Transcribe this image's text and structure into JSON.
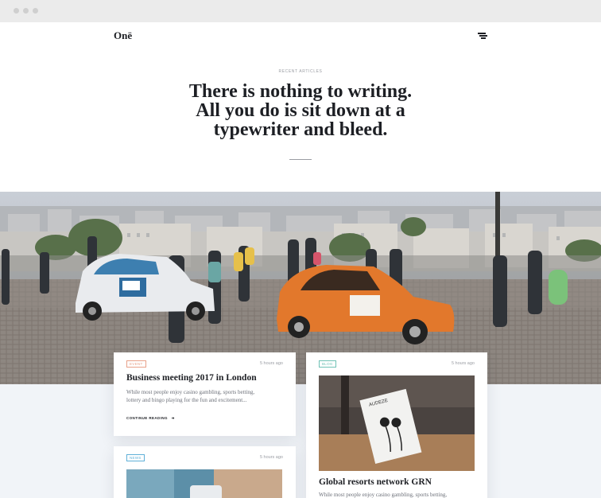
{
  "browser": {
    "dots": [
      "close",
      "minimize",
      "maximize"
    ]
  },
  "header": {
    "logo": "Onë",
    "menu_icon": "hamburger-icon"
  },
  "hero_intro": {
    "eyebrow": "RECENT ARTICLES",
    "headline_lines": [
      "There is nothing to writing.",
      "All you do is sit down at a",
      "typewriter and bleed."
    ]
  },
  "hero_image": {
    "description_icon": "paris-street-photo"
  },
  "cards": [
    {
      "tag": "EVENT",
      "tag_color": "#e8a189",
      "time": "5 hours ago",
      "title": "Business meeting 2017 in London",
      "excerpt_lines": [
        "While most people enjoy casino gambling, sports betting,",
        "lottery and bingo playing for the fun and excitement..."
      ],
      "cta": "CONTINUE READING"
    },
    {
      "tag": "BLOG",
      "tag_color": "#6fc1b5",
      "time": "5 hours ago",
      "title": "Global resorts network GRN",
      "excerpt_lines": [
        "While most people enjoy casino gambling, sports betting,"
      ]
    },
    {
      "tag": "NEWS",
      "tag_color": "#5fb0d8",
      "time": "5 hours ago"
    }
  ],
  "product_box_text": "AUDEZE"
}
